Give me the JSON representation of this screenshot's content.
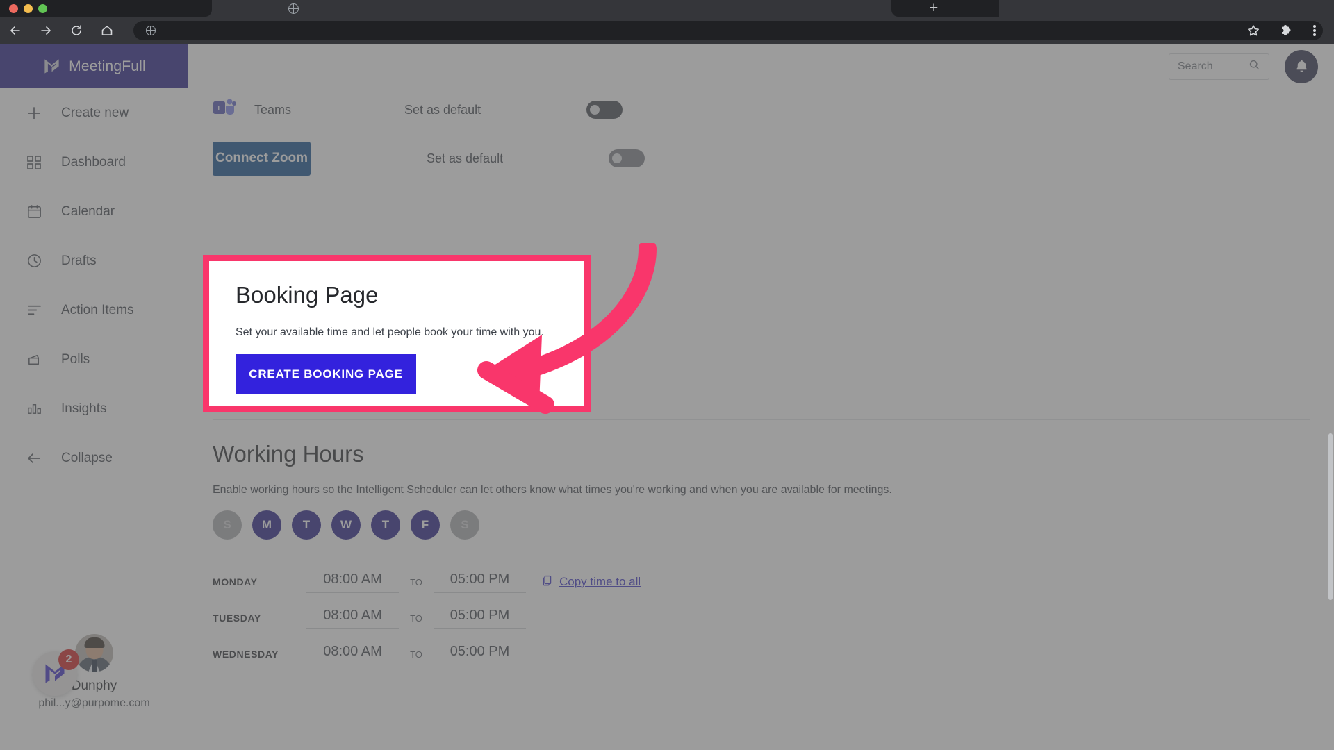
{
  "browser": {
    "tab_title": "",
    "url": "",
    "new_tab_label": "+",
    "icons": {
      "back": "back-arrow-icon",
      "forward": "forward-arrow-icon",
      "reload": "reload-icon",
      "home": "home-icon",
      "bookmark": "star-icon",
      "extensions": "puzzle-piece-icon",
      "menu": "three-dot-menu-icon"
    }
  },
  "sidebar": {
    "brand": "MeetingFull",
    "items": [
      {
        "label": "Create new",
        "icon": "plus-icon"
      },
      {
        "label": "Dashboard",
        "icon": "grid-icon"
      },
      {
        "label": "Calendar",
        "icon": "calendar-icon"
      },
      {
        "label": "Drafts",
        "icon": "clock-icon"
      },
      {
        "label": "Action Items",
        "icon": "list-icon"
      },
      {
        "label": "Polls",
        "icon": "poll-box-icon"
      },
      {
        "label": "Insights",
        "icon": "bar-chart-icon"
      },
      {
        "label": "Collapse",
        "icon": "left-arrow-icon"
      }
    ],
    "profile": {
      "name": "Dunphy",
      "email": "phil...y@purpome.com"
    },
    "widget": {
      "badge_count": "2",
      "icon": "meetingfull-logo-icon"
    }
  },
  "topbar": {
    "search_placeholder": "Search",
    "search_value": "",
    "search_icon": "search-icon",
    "bell_icon": "bell-icon"
  },
  "integrations": [
    {
      "name": "Teams",
      "default_label": "Set as default",
      "toggle_on": false,
      "icon": "microsoft-teams-icon"
    },
    {
      "name": "",
      "default_label": "Set as default",
      "toggle_on": false,
      "button_label": "Connect Zoom"
    }
  ],
  "booking": {
    "title": "Booking Page",
    "description": "Set your available time and let people book your time with you.",
    "cta_label": "CREATE BOOKING PAGE"
  },
  "working_hours": {
    "title": "Working Hours",
    "description": "Enable working hours so the Intelligent Scheduler can let others know what times you're working and when you are available for meetings.",
    "days": [
      {
        "letter": "S",
        "active": false
      },
      {
        "letter": "M",
        "active": true
      },
      {
        "letter": "T",
        "active": true
      },
      {
        "letter": "W",
        "active": true
      },
      {
        "letter": "T",
        "active": true
      },
      {
        "letter": "F",
        "active": true
      },
      {
        "letter": "S",
        "active": false
      }
    ],
    "to_label": "TO",
    "copy_label": "Copy time to all",
    "copy_icon": "copy-icon",
    "rows": [
      {
        "day": "MONDAY",
        "start": "08:00 AM",
        "end": "05:00 PM",
        "has_copy": true
      },
      {
        "day": "TUESDAY",
        "start": "08:00 AM",
        "end": "05:00 PM",
        "has_copy": false
      },
      {
        "day": "WEDNESDAY",
        "start": "08:00 AM",
        "end": "05:00 PM",
        "has_copy": false
      }
    ]
  },
  "chat": {
    "icon": "chat-bubble-icon"
  },
  "colors": {
    "brand_indigo": "#241c87",
    "cta_blue": "#3322dd",
    "zoom_blue": "#0f4c8f",
    "highlight_pink": "#f9366b",
    "badge_red": "#d21f1f"
  }
}
